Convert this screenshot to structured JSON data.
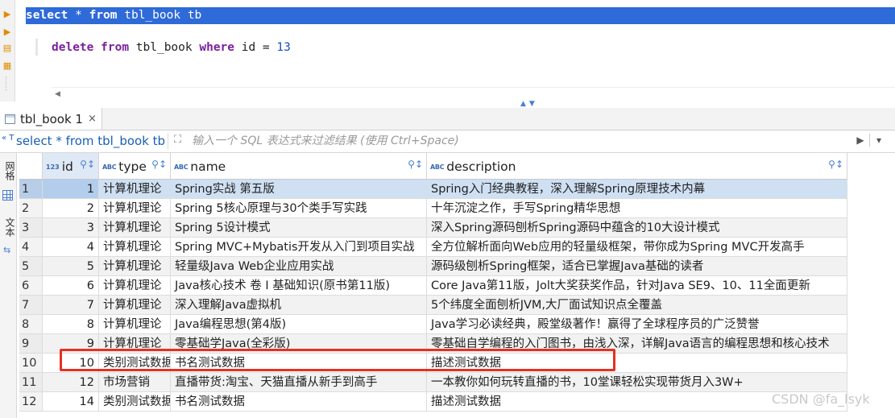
{
  "editor": {
    "lines": [
      {
        "parts": [
          {
            "t": "select",
            "kw": true
          },
          {
            "t": " * "
          },
          {
            "t": "from",
            "kw": true
          },
          {
            "t": " tbl_book tb"
          }
        ]
      },
      {
        "parts": [
          {
            "t": "delete",
            "kw": true
          },
          {
            "t": " "
          },
          {
            "t": "from",
            "kw": true
          },
          {
            "t": " tbl_book "
          },
          {
            "t": "where",
            "kw": true
          },
          {
            "t": " id = "
          },
          {
            "t": "13",
            "num": true
          }
        ]
      }
    ]
  },
  "result_tab": {
    "label": "tbl_book 1",
    "close": "×"
  },
  "filter": {
    "sql_badge": "« T",
    "sql_text": "select * from tbl_book tb",
    "placeholder": "输入一个 SQL 表达式来过滤结果 (使用 Ctrl+Space)",
    "run_icon": "▶",
    "dropdown_icon": "▾"
  },
  "side_panel": {
    "grid_tab": "网格",
    "text_tab": "文本"
  },
  "grid": {
    "columns": [
      {
        "key": "id",
        "label": "id",
        "icon": "123"
      },
      {
        "key": "type",
        "label": "type",
        "icon": "ABC"
      },
      {
        "key": "name",
        "label": "name",
        "icon": "ABC"
      },
      {
        "key": "description",
        "label": "description",
        "icon": "ABC"
      }
    ],
    "rows": [
      {
        "n": "1",
        "id": "1",
        "type": "计算机理论",
        "name": "Spring实战 第五版",
        "description": "Spring入门经典教程，深入理解Spring原理技术内幕"
      },
      {
        "n": "2",
        "id": "2",
        "type": "计算机理论",
        "name": "Spring 5核心原理与30个类手写实践",
        "description": "十年沉淀之作，手写Spring精华思想"
      },
      {
        "n": "3",
        "id": "3",
        "type": "计算机理论",
        "name": "Spring 5设计模式",
        "description": "深入Spring源码刨析Spring源码中蕴含的10大设计模式"
      },
      {
        "n": "4",
        "id": "4",
        "type": "计算机理论",
        "name": "Spring MVC+Mybatis开发从入门到项目实战",
        "description": "全方位解析面向Web应用的轻量级框架，带你成为Spring MVC开发高手"
      },
      {
        "n": "5",
        "id": "5",
        "type": "计算机理论",
        "name": "轻量级Java Web企业应用实战",
        "description": "源码级刨析Spring框架，适合已掌握Java基础的读者"
      },
      {
        "n": "6",
        "id": "6",
        "type": "计算机理论",
        "name": "Java核心技术 卷 I  基础知识(原书第11版)",
        "description": "Core Java第11版，Jolt大奖获奖作品，针对Java SE9、10、11全面更新"
      },
      {
        "n": "7",
        "id": "7",
        "type": "计算机理论",
        "name": "深入理解Java虚拟机",
        "description": "5个纬度全面刨析JVM,大厂面试知识点全覆盖"
      },
      {
        "n": "8",
        "id": "8",
        "type": "计算机理论",
        "name": "Java编程思想(第4版)",
        "description": "Java学习必读经典，殿堂级著作！赢得了全球程序员的广泛赞誉"
      },
      {
        "n": "9",
        "id": "9",
        "type": "计算机理论",
        "name": "零基础学Java(全彩版)",
        "description": "零基础自学编程的入门图书，由浅入深，详解Java语言的编程思想和核心技术"
      },
      {
        "n": "10",
        "id": "10",
        "type": "类别测试数据",
        "name": "书名测试数据",
        "description": "描述测试数据"
      },
      {
        "n": "11",
        "id": "12",
        "type": "市场营销",
        "name": "直播带货:淘宝、天猫直播从新手到高手",
        "description": "一本教你如何玩转直播的书，10堂课轻松实现带货月入3W+"
      },
      {
        "n": "12",
        "id": "14",
        "type": "类别测试数据",
        "name": "书名测试数据",
        "description": "描述测试数据"
      }
    ]
  },
  "watermark": "CSDN @fa_lsyk",
  "colors": {
    "selection": "#2e6ad8",
    "keyword": "#7a1fa0",
    "number": "#1750c4",
    "highlight": "#e53023"
  }
}
